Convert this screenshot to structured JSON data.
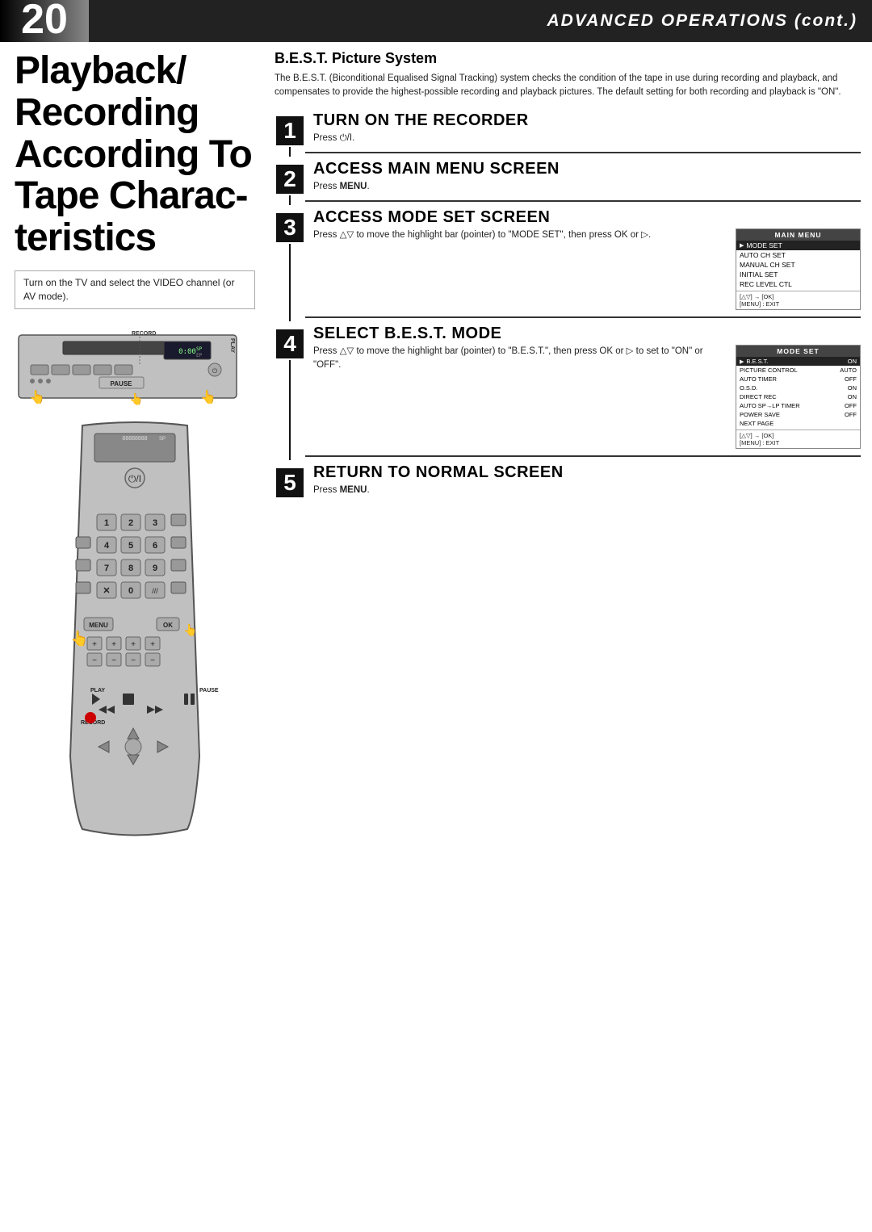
{
  "header": {
    "page_number": "20",
    "title": "ADVANCED OPERATIONS (cont.)"
  },
  "page_title": "Playback/ Recording According To Tape Charac-teristics",
  "tv_note": "Turn on the TV and select the VIDEO channel (or AV mode).",
  "best_section": {
    "title": "B.E.S.T. Picture System",
    "description": "The B.E.S.T. (Biconditional Equalised Signal Tracking) system checks the condition of the tape in use during recording and playback, and compensates to provide the highest-possible recording and playback pictures. The default setting for both recording and playback is \"ON\"."
  },
  "steps": [
    {
      "number": "1",
      "heading": "TURN ON THE RECORDER",
      "instruction": "Press ⏻/I."
    },
    {
      "number": "2",
      "heading": "ACCESS MAIN MENU SCREEN",
      "instruction": "Press MENU ."
    },
    {
      "number": "3",
      "heading": "ACCESS MODE SET SCREEN",
      "instruction": "Press △▽ to move the highlight bar (pointer) to \"MODE SET\", then press OK or ▷.",
      "screen": {
        "title": "MAIN MENU",
        "rows": [
          {
            "label": "MODE SET",
            "highlighted": true
          },
          {
            "label": "AUTO CH SET",
            "highlighted": false
          },
          {
            "label": "MANUAL CH SET",
            "highlighted": false
          },
          {
            "label": "INITIAL SET",
            "highlighted": false
          },
          {
            "label": "REC LEVEL CTL",
            "highlighted": false
          }
        ],
        "footer": "[△▽] → [OK]",
        "footer2": "[MENU] : EXIT"
      }
    },
    {
      "number": "4",
      "heading": "SELECT B.E.S.T. MODE",
      "instruction": "Press △▽ to move the highlight bar (pointer) to \"B.E.S.T.\", then press OK or ▷ to set to \"ON\" or \"OFF\".",
      "screen": {
        "title": "MODE SET",
        "rows": [
          {
            "label": "B.E.S.T.",
            "value": "ON",
            "highlighted": true
          },
          {
            "label": "PICTURE CONTROL",
            "value": "AUTO",
            "highlighted": false
          },
          {
            "label": "AUTO TIMER",
            "value": "OFF",
            "highlighted": false
          },
          {
            "label": "O.S.D.",
            "value": "ON",
            "highlighted": false
          },
          {
            "label": "DIRECT REC",
            "value": "ON",
            "highlighted": false
          },
          {
            "label": "AUTO SP→LP TIMER",
            "value": "OFF",
            "highlighted": false
          },
          {
            "label": "POWER SAVE",
            "value": "OFF",
            "highlighted": false
          },
          {
            "label": "NEXT PAGE",
            "value": "",
            "highlighted": false
          }
        ],
        "footer": "[△▽] → [OK]",
        "footer2": "[MENU] : EXIT"
      }
    },
    {
      "number": "5",
      "heading": "RETURN TO NORMAL SCREEN",
      "instruction": "Press MENU ."
    }
  ],
  "remote_labels": {
    "menu": "MENU",
    "ok": "OK",
    "play": "PLAY",
    "record": "RECORD",
    "pause": "PAUSE"
  }
}
